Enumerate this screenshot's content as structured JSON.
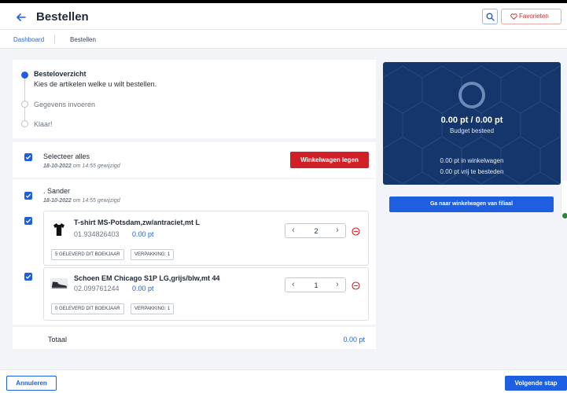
{
  "header": {
    "title": "Bestellen",
    "favorites_label": "Favorieten"
  },
  "breadcrumb": {
    "link": "Dashboard",
    "current": "Bestellen"
  },
  "steps": [
    {
      "title": "Besteloverzicht",
      "subtitle": "Kies de artikelen welke u wilt bestellen."
    },
    {
      "title": "Gegevens invoeren"
    },
    {
      "title": "Klaar!"
    }
  ],
  "cart": {
    "select_all_label": "Selecteer alles",
    "select_all_date": "18-10-2022",
    "select_all_time_text": "om 14:55 gewijzigd",
    "clear_button": "Winkelwagen legen",
    "group": {
      "name": ". Sander",
      "date": "18-10-2022",
      "time_text": "om 14:55 gewijzigd"
    },
    "items": [
      {
        "name": "T-shirt MS-Potsdam,zw/antraciet,mt L",
        "code": "01.934826403",
        "price": "0.00 pt",
        "quantity": "2",
        "tags": [
          "5 GELEVERD DIT BOEKJAAR",
          "VERPAKKING: 1"
        ]
      },
      {
        "name": "Schoen EM Chicago S1P LG,grijs/blw,mt 44",
        "code": "02.099761244",
        "price": "0.00 pt",
        "quantity": "1",
        "tags": [
          "0 GELEVERD DIT BOEKJAAR",
          "VERPAKKING: 1"
        ]
      }
    ],
    "total_label": "Totaal",
    "total_value": "0.00 pt"
  },
  "budget": {
    "amount": "0.00 pt / 0.00 pt",
    "label": "Budget besteed",
    "in_cart": "0.00 pt in winkelwagen",
    "free": "0.00 pt vrij te besteden"
  },
  "branch_cart_button": "Ga naar winkelwagen van filiaal",
  "footer": {
    "cancel_label": "Annuleren",
    "next_label": "Volgende stap"
  },
  "colors": {
    "primary": "#1d5fe0",
    "danger": "#d01f26",
    "budget_bg": "#14366b"
  }
}
